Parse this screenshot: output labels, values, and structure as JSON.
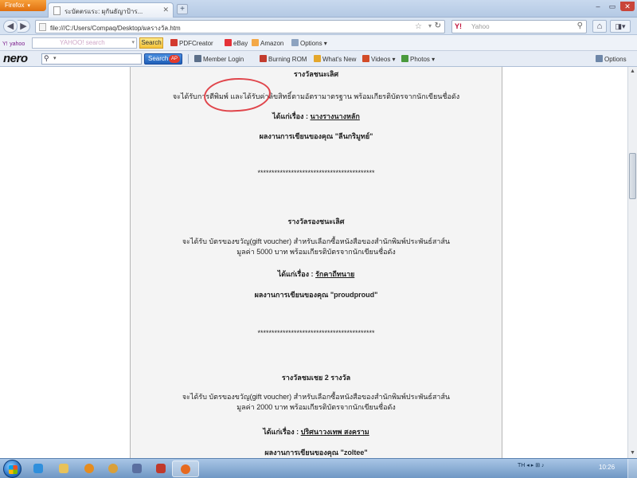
{
  "browser": {
    "app_button": "Firefox",
    "tab": {
      "title": "ระบัตตรแระ: ผุกันธัญาป้าร..."
    },
    "new_tab": "+",
    "window_controls": {
      "minimize": "–",
      "maximize": "▭",
      "close": "✕"
    },
    "nav": {
      "back": "◀",
      "forward": "▶",
      "home": "⌂",
      "menu": "◨▾"
    },
    "url": "file:///C:/Users/Compaq/Desktop/ผลรางวัล.htm",
    "search": {
      "engine_label": "Y!",
      "placeholder": "Yahoo"
    }
  },
  "yahoo_toolbar": {
    "logo": "Y!",
    "logo_sub": "yahoo",
    "search_placeholder": "YAHOO! search",
    "search_button": "Search",
    "items": [
      "PDFCreator",
      "eBay",
      "Amazon",
      "Options"
    ]
  },
  "nero_toolbar": {
    "logo": "nero",
    "search_button": "Search",
    "badge": "AP",
    "items": [
      "Member Login",
      "Burning ROM",
      "What's New",
      "Videos",
      "Photos"
    ],
    "options": "Options"
  },
  "document": {
    "lines": [
      {
        "text": "รางวัลชนะเลิศ",
        "style": "bold"
      },
      {
        "text": "จะได้รับการตีพิมพ์ และได้รับค่าลิขสิทธิ์ตามอัตรามาตรฐาน พร้อมเกียรติบัตรจากนักเขียนชื่อดัง",
        "style": "normal"
      },
      {
        "label": "ได้แก่เรื่อง :",
        "title": "นางรางนางหลัก",
        "style": "title"
      },
      {
        "text": "ผลงานการเขียนของคุณ \"ลีนกริมูทย์\"",
        "style": "bold"
      },
      {
        "text": "******************************************",
        "style": "normal"
      },
      {
        "text": "รางวัลรองชนะเลิศ",
        "style": "bold"
      },
      {
        "text": "จะได้รับ บัตรของขวัญ(gift voucher) สำหรับเลือกซื้อหนังสือของสำนักพิมพ์ประพันธ์สาส์น",
        "style": "normal"
      },
      {
        "text": "มูลค่า 5000 บาท พร้อมเกียรติบัตรจากนักเขียนชื่อดัง",
        "style": "normal"
      },
      {
        "label": "ได้แก่เรื่อง :",
        "title": "รักคาถีทนาย",
        "style": "title"
      },
      {
        "text": "ผลงานการเขียนของคุณ \"proudproud\"",
        "style": "bold"
      },
      {
        "text": "******************************************",
        "style": "normal"
      },
      {
        "text": "รางวัลชมเชย 2 รางวัล",
        "style": "bold"
      },
      {
        "text": "จะได้รับ บัตรของขวัญ(gift voucher) สำหรับเลือกซื้อหนังสือของสำนักพิมพ์ประพันธ์สาส์น",
        "style": "normal"
      },
      {
        "text": "มูลค่า 2000 บาท พร้อมเกียรติบัตรจากนักเขียนชื่อดัง",
        "style": "normal"
      },
      {
        "label": "ได้แก่เรื่อง :",
        "title": "ปริศนาวงเทพ สงคราม",
        "style": "title"
      },
      {
        "text": "ผลงานการเขียนของคุณ \"zoltee\"",
        "style": "bold"
      }
    ]
  },
  "annotation_color": "#e0454b",
  "taskbar": {
    "tray": "TH  ◂  ▸  ⊞  ♪",
    "clock": "10:26"
  }
}
